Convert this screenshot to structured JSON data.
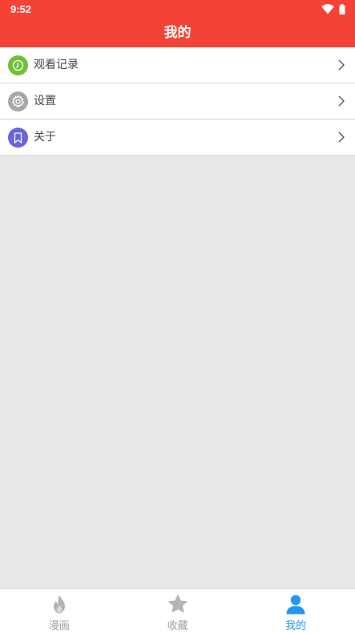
{
  "status_bar": {
    "time": "9:52",
    "icons": [
      "wifi-icon",
      "battery-icon"
    ]
  },
  "app_bar": {
    "title": "我的",
    "color": "#f44336"
  },
  "menu": {
    "items": [
      {
        "label": "观看记录",
        "icon": "clock-icon",
        "icon_color": "#6cc137"
      },
      {
        "label": "设置",
        "icon": "gear-icon",
        "icon_color": "#a8a8a8"
      },
      {
        "label": "关于",
        "icon": "bookmark-icon",
        "icon_color": "#6a63dd"
      }
    ]
  },
  "bottom_nav": {
    "items": [
      {
        "label": "漫画",
        "icon": "flame-icon",
        "active": false
      },
      {
        "label": "收藏",
        "icon": "star-icon",
        "active": false
      },
      {
        "label": "我的",
        "icon": "person-icon",
        "active": true
      }
    ],
    "active_color": "#2196f3",
    "inactive_color": "#9e9e9e"
  }
}
